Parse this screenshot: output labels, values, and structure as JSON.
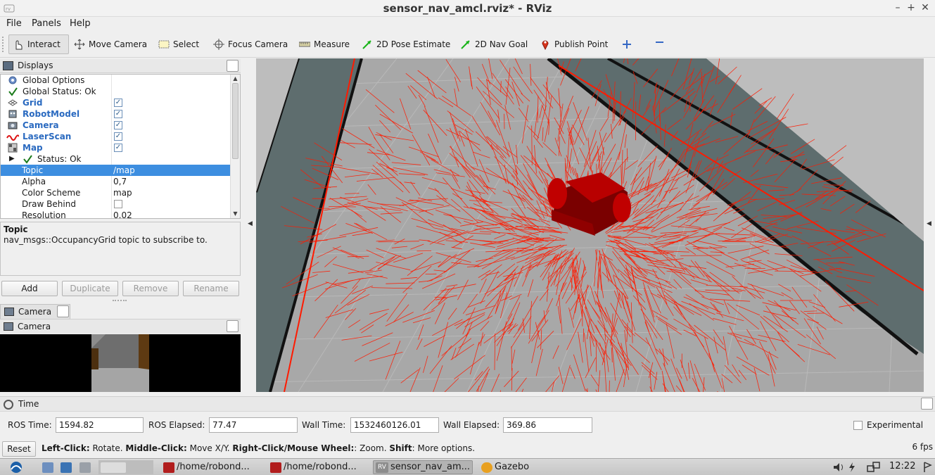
{
  "window": {
    "title": "sensor_nav_amcl.rviz* - RViz",
    "app_icon": "rviz-logo-icon",
    "controls": [
      "minimize",
      "maximize",
      "close"
    ]
  },
  "menu": [
    {
      "label": "File"
    },
    {
      "label": "Panels"
    },
    {
      "label": "Help"
    }
  ],
  "toolbar": {
    "tools": [
      {
        "label": "Interact",
        "icon": "cursor-icon",
        "active": true
      },
      {
        "label": "Move Camera",
        "icon": "move-icon"
      },
      {
        "label": "Select",
        "icon": "select-box-icon"
      },
      {
        "label": "Focus Camera",
        "icon": "crosshair-icon"
      },
      {
        "label": "Measure",
        "icon": "ruler-icon"
      },
      {
        "label": "2D Pose Estimate",
        "icon": "green-arrow-icon"
      },
      {
        "label": "2D Nav Goal",
        "icon": "green-arrow-icon"
      },
      {
        "label": "Publish Point",
        "icon": "map-pin-icon"
      }
    ]
  },
  "displays": {
    "title": "Displays",
    "rows": [
      {
        "name": "Global Options",
        "value": ""
      },
      {
        "name": "Global Status: Ok",
        "value": ""
      },
      {
        "name": "Grid",
        "value": "",
        "checked": true
      },
      {
        "name": "RobotModel",
        "value": "",
        "checked": true
      },
      {
        "name": "Camera",
        "value": "",
        "checked": true
      },
      {
        "name": "LaserScan",
        "value": "",
        "checked": true
      },
      {
        "name": "Map",
        "value": "",
        "checked": true
      },
      {
        "name": "Status: Ok",
        "value": ""
      },
      {
        "name": "Topic",
        "value": "/map",
        "selected": true
      },
      {
        "name": "Alpha",
        "value": "0,7"
      },
      {
        "name": "Color Scheme",
        "value": "map"
      },
      {
        "name": "Draw Behind",
        "value": "",
        "checked": false
      },
      {
        "name": "Resolution",
        "value": "0.02"
      }
    ],
    "description_title": "Topic",
    "description_text": "nav_msgs::OccupancyGrid topic to subscribe to.",
    "buttons": {
      "add": "Add",
      "duplicate": "Duplicate",
      "remove": "Remove",
      "rename": "Rename"
    }
  },
  "camera_panel": {
    "tab_label": "Camera",
    "header_label": "Camera"
  },
  "time_panel": {
    "title": "Time",
    "ros_time_label": "ROS Time:",
    "ros_time": "1594.82",
    "ros_elapsed_label": "ROS Elapsed:",
    "ros_elapsed": "77.47",
    "wall_time_label": "Wall Time:",
    "wall_time": "1532460126.01",
    "wall_elapsed_label": "Wall Elapsed:",
    "wall_elapsed": "369.86",
    "experimental_label": "Experimental"
  },
  "status_bar": {
    "reset": "Reset",
    "hint_parts": [
      {
        "b": "Left-Click:",
        "t": " Rotate. "
      },
      {
        "b": "Middle-Click:",
        "t": " Move X/Y. "
      },
      {
        "b": "Right-Click/Mouse Wheel:",
        "t": ": Zoom. "
      },
      {
        "b": "Shift",
        "t": ": More options."
      }
    ],
    "fps": "6 fps"
  },
  "taskbar": {
    "items": [
      {
        "label": "/home/robond...",
        "icon": "terminal-icon"
      },
      {
        "label": "/home/robond...",
        "icon": "terminal-icon"
      },
      {
        "label": "sensor_nav_am...",
        "icon": "rviz-icon",
        "active": true
      },
      {
        "label": "Gazebo",
        "icon": "gazebo-icon"
      }
    ],
    "clock": "12:22"
  },
  "colors": {
    "laser": "#ff1a00",
    "robot": "#b80000",
    "floor": "#a8a8a8",
    "wall": "#5e6d6e",
    "selection": "#3d8ee0"
  }
}
